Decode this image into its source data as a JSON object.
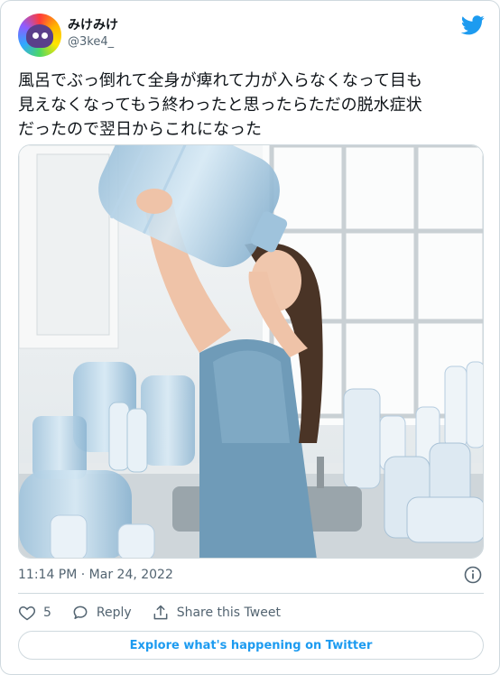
{
  "author": {
    "name": "みけみけ",
    "handle": "@3ke4_"
  },
  "tweet": {
    "text": "風呂でぶっ倒れて全身が痺れて力が入らなくなって目も\n見えなくなってもう終わったと思ったらただの脱水症状\nだったので翌日からこれになった",
    "timestamp": "11:14 PM · Mar 24, 2022"
  },
  "actions": {
    "like_count": "5",
    "reply_label": "Reply",
    "share_label": "Share this Tweet"
  },
  "footer": {
    "explore_label": "Explore what's happening on Twitter"
  },
  "colors": {
    "brand": "#1d9bf0",
    "text": "#0f1419",
    "muted": "#536471",
    "border": "#cfd9de"
  },
  "icons": [
    "twitter-bird-icon",
    "info-icon",
    "heart-icon",
    "reply-icon",
    "share-icon"
  ]
}
